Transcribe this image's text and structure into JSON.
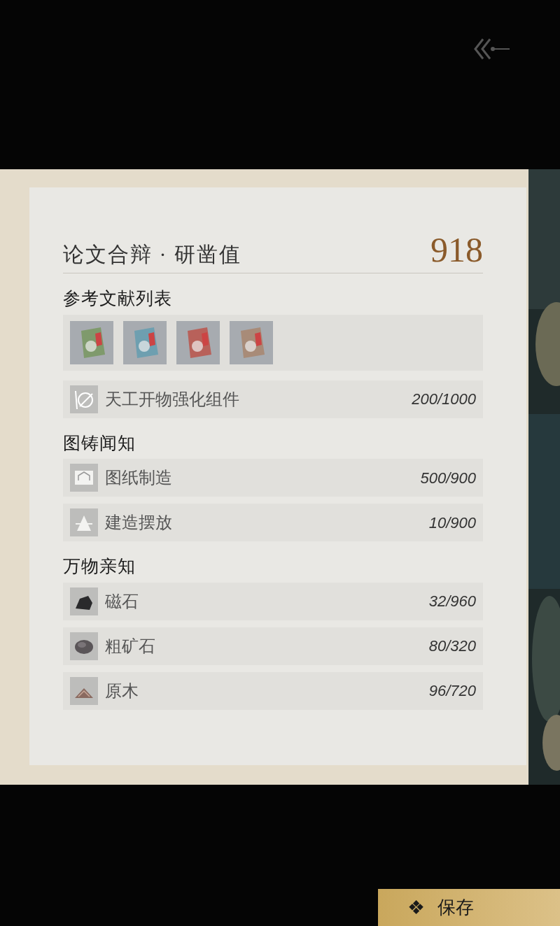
{
  "header": {
    "title": "论文合辩 · 研凿值",
    "score": "918"
  },
  "sections": [
    {
      "title": "参考文献列表",
      "books": [
        {
          "color": "#7f9a6c"
        },
        {
          "color": "#6e9fb0"
        },
        {
          "color": "#b8615a"
        },
        {
          "color": "#a88b78"
        }
      ],
      "rows": [
        {
          "kind": "component",
          "label": "天工开物强化组件",
          "value": "200/1000"
        }
      ]
    },
    {
      "title": "图铸闻知",
      "rows": [
        {
          "kind": "blueprint",
          "label": "图纸制造",
          "value": "500/900"
        },
        {
          "kind": "building",
          "label": "建造摆放",
          "value": "10/900"
        }
      ]
    },
    {
      "title": "万物亲知",
      "rows": [
        {
          "kind": "magnet",
          "label": "磁石",
          "value": "32/960"
        },
        {
          "kind": "ore",
          "label": "粗矿石",
          "value": "80/320"
        },
        {
          "kind": "wood",
          "label": "原木",
          "value": "96/720"
        }
      ]
    }
  ],
  "save_button": {
    "icon": "❖",
    "label": "保存"
  }
}
